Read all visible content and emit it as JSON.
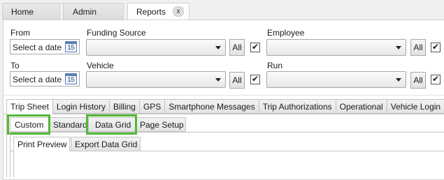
{
  "top_tabs": [
    {
      "label": "Home"
    },
    {
      "label": "Admin"
    },
    {
      "label": "Reports",
      "close": "x"
    }
  ],
  "filters": {
    "from_label": "From",
    "from_placeholder": "Select a date",
    "to_label": "To",
    "to_placeholder": "Select a date",
    "calendar_day": "15",
    "funding_source_label": "Funding Source",
    "vehicle_label": "Vehicle",
    "employee_label": "Employee",
    "run_label": "Run",
    "all_label": "All",
    "check_glyph": "✔"
  },
  "report_tabs": [
    {
      "label": "Trip Sheet"
    },
    {
      "label": "Login History"
    },
    {
      "label": "Billing"
    },
    {
      "label": "GPS"
    },
    {
      "label": "Smartphone Messages"
    },
    {
      "label": "Trip Authorizations"
    },
    {
      "label": "Operational"
    },
    {
      "label": "Vehicle Login"
    }
  ],
  "sub_tabs": [
    {
      "label": "Custom"
    },
    {
      "label": "Standard"
    },
    {
      "label": "Data Grid"
    },
    {
      "label": "Page Setup"
    }
  ],
  "view_tabs": [
    {
      "label": "Print Preview"
    },
    {
      "label": "Export Data Grid"
    }
  ],
  "colors": {
    "highlight": "#52b838",
    "calendar": "#5a7fb5"
  }
}
